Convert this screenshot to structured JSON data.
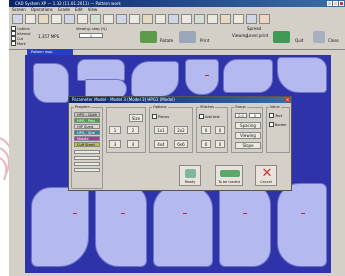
{
  "window": {
    "title": "CAD System XP — 1.32 (11.01.2011) — Pattern work"
  },
  "menu": [
    "Screen",
    "Operations",
    "Grade",
    "Edit",
    "View"
  ],
  "options": [
    "Outline",
    "Internal",
    "Cut",
    "Mark"
  ],
  "toolbar": {
    "size_label": "1,357 MPS",
    "viewing_label": "Viewing: step (%)",
    "step_value": "1",
    "rotate_label": "Rotate",
    "print_label": "Print",
    "spread_label": "Spread",
    "viewing_btn": "Viewing",
    "level_label": "Level print",
    "quit_label": "Quit",
    "close_label": "Close"
  },
  "map_tab": "Pattern map",
  "dialog": {
    "title": "Parameter Model - Model 3 (Model 3) HPG1 (Model)",
    "groups": {
      "program": "Program",
      "options": "Options",
      "stitch": "Stitches",
      "group": "Group",
      "value": "Value"
    },
    "list": [
      "HPG - Cloth",
      "HPG - Poly",
      "HIP Sized",
      "HPG - Size",
      "Middle Sized",
      "Cuff Sized"
    ],
    "fields": {
      "size_label": "Size",
      "pieces_label": "Pieces",
      "add_label": "Add text",
      "counts": [
        "1",
        "2",
        "3",
        "4"
      ],
      "mults": [
        "1x1",
        "2x2",
        "4x4",
        "6x6"
      ],
      "zeros": [
        "0",
        "0",
        "0",
        "0"
      ],
      "nums": [
        "0",
        "0"
      ],
      "value_1": "0.0",
      "value_2": "0",
      "spacing_label": "Spacing",
      "viewing_label": "Viewing",
      "text_label": "Text",
      "border_label": "Border",
      "slope_label": "Slope"
    },
    "buttons": {
      "ok": "Ready",
      "transfer": "To be traded",
      "cancel": "Cancel"
    }
  },
  "colors": {
    "canvas": "#2e33aa",
    "piece": "#b4b9ef",
    "accent": "#c84030"
  }
}
